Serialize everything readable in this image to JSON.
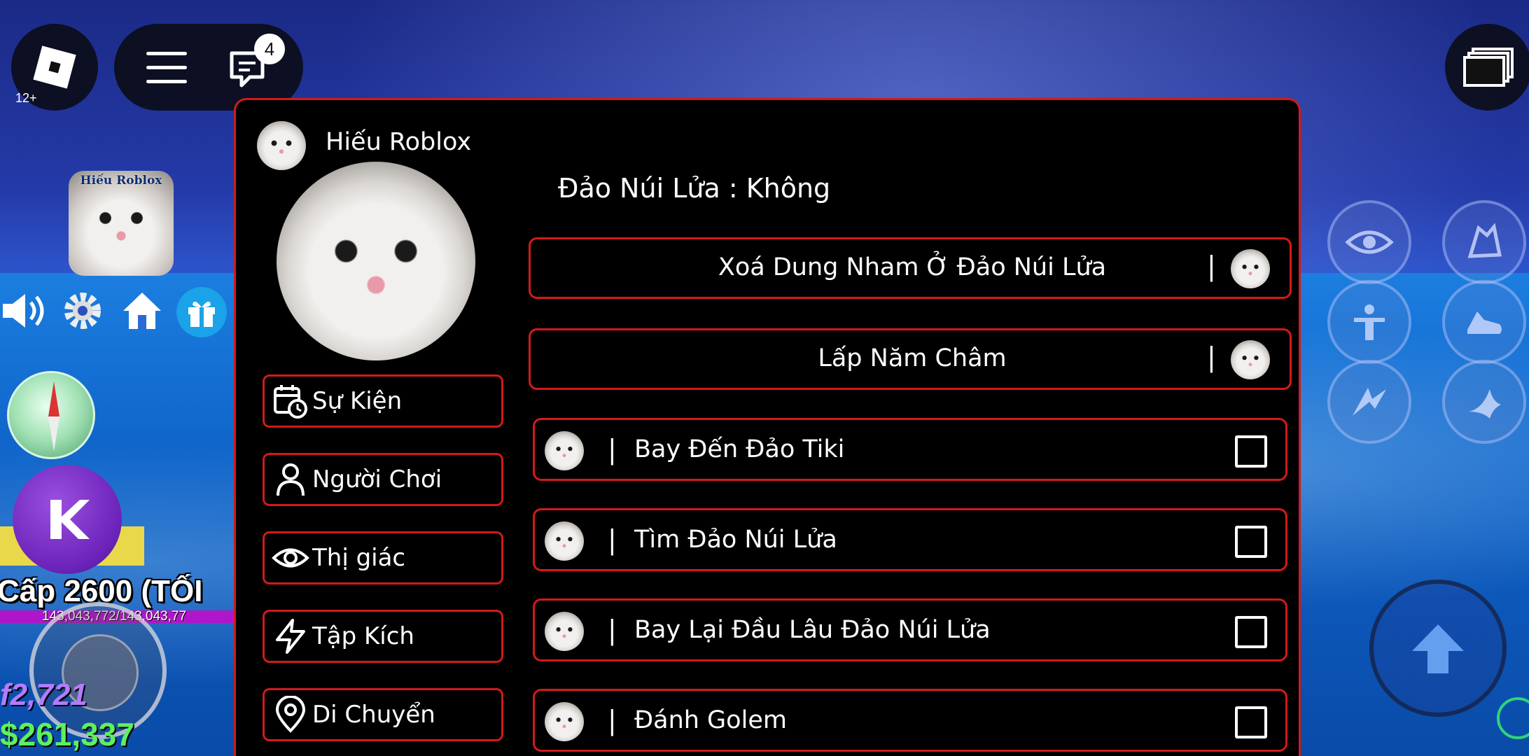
{
  "topbar": {
    "age_rating": "12+",
    "chat_badge_count": "4"
  },
  "hud": {
    "avatar_tag": "Hiếu Roblox",
    "level_text": "Cấp 2600 (TỐI",
    "xp_text": "143,043,772/143,043,77",
    "fragments": "f2,721",
    "money": "$261,337"
  },
  "panel": {
    "user_name": "Hiếu Roblox",
    "tabs": [
      {
        "label": "Sự Kiện",
        "icon": "calendar-clock-icon"
      },
      {
        "label": "Người Chơi",
        "icon": "user-icon"
      },
      {
        "label": "Thị giác",
        "icon": "eye-icon"
      },
      {
        "label": "Tập Kích",
        "icon": "lightning-icon"
      },
      {
        "label": "Di Chuyển",
        "icon": "map-pin-icon"
      }
    ],
    "status": "Đảo Núi Lửa : Không",
    "actions": [
      {
        "label": "Xoá Dung Nham Ở Đảo Núi Lửa",
        "separator": "|"
      },
      {
        "label": "Lấp Năm Châm",
        "separator": "|"
      }
    ],
    "toggles": [
      {
        "label": "Bay Đến Đảo Tiki",
        "separator": "|",
        "checked": false
      },
      {
        "label": "Tìm Đảo Núi Lửa",
        "separator": "|",
        "checked": false
      },
      {
        "label": "Bay Lại Đầu Lâu Đảo Núi Lửa",
        "separator": "|",
        "checked": false
      },
      {
        "label": "Đánh Golem",
        "separator": "|",
        "checked": false
      }
    ]
  },
  "colors": {
    "panel_bg": "#000000",
    "accent_border": "#d21a1a",
    "money": "#5ef05e",
    "fragments": "#b57bff",
    "xp_bar": "#b016c9"
  }
}
